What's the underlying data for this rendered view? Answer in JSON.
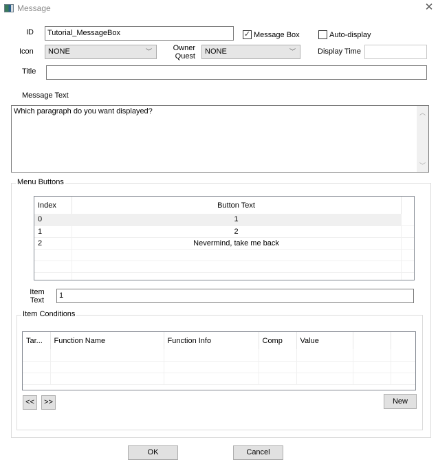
{
  "window": {
    "title": "Message",
    "icon": "app-window-icon",
    "close_icon": "close-icon"
  },
  "form": {
    "id_label": "ID",
    "id_value": "Tutorial_MessageBox",
    "message_box_label": "Message Box",
    "message_box_checked": true,
    "auto_display_label": "Auto-display",
    "auto_display_checked": false,
    "icon_label": "Icon",
    "icon_value": "NONE",
    "owner_quest_label_line1": "Owner",
    "owner_quest_label_line2": "Quest",
    "owner_quest_value": "NONE",
    "display_time_label": "Display Time",
    "display_time_value": "",
    "title_label": "Title",
    "title_value": "",
    "message_text_label": "Message Text",
    "message_text_value": "Which paragraph do you want displayed?"
  },
  "menu_buttons": {
    "group_label": "Menu Buttons",
    "columns": [
      "Index",
      "Button Text"
    ],
    "rows": [
      {
        "index": "0",
        "text": "1",
        "selected": true
      },
      {
        "index": "1",
        "text": "2",
        "selected": false
      },
      {
        "index": "2",
        "text": "Nevermind, take me back",
        "selected": false
      }
    ],
    "item_text_label_line1": "Item",
    "item_text_label_line2": "Text",
    "item_text_value": "1"
  },
  "item_conditions": {
    "group_label": "Item Conditions",
    "columns": [
      "Tar...",
      "Function Name",
      "Function Info",
      "Comp",
      "Value",
      "",
      ""
    ],
    "prev_label": "<<",
    "next_label": ">>",
    "new_label": "New"
  },
  "footer": {
    "ok_label": "OK",
    "cancel_label": "Cancel"
  }
}
